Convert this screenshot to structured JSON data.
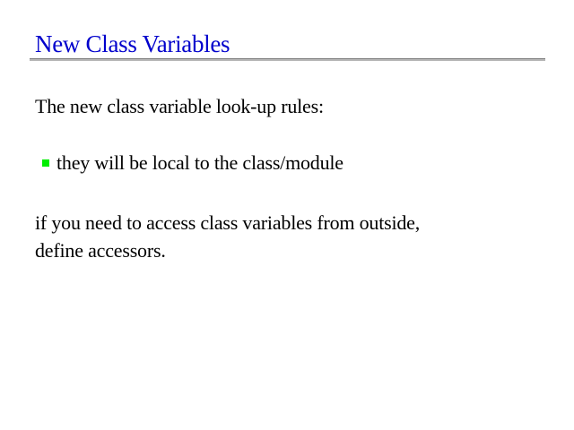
{
  "slide": {
    "title": "New Class Variables",
    "intro": "The new class variable look-up rules:",
    "bullets": [
      {
        "text": "they will be local to the class/module",
        "marker": "green-square-bullet",
        "marker_color": "#00ee00"
      }
    ],
    "outro_lines": [
      "if you need to access class variables from outside,",
      "define accessors."
    ]
  },
  "colors": {
    "title": "#0000cc",
    "rule": "#7f7f7f",
    "text": "#000000",
    "background": "#ffffff"
  }
}
